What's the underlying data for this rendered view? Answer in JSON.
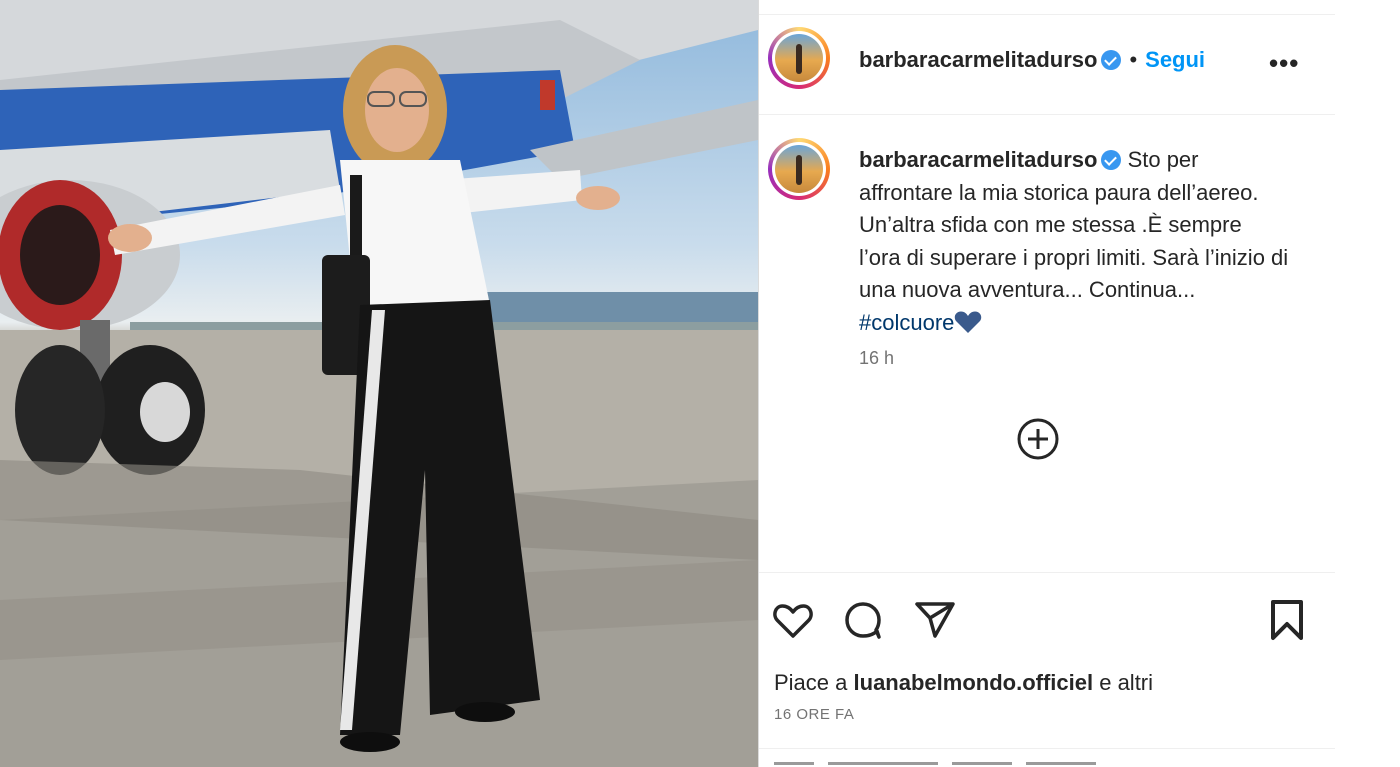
{
  "post": {
    "username": "barbaracarmelitadurso",
    "verified": true,
    "separator": "•",
    "follow_label": "Segui",
    "more_label": "•••"
  },
  "caption": {
    "username": "barbaracarmelitadurso",
    "text": "Sto per affrontare la mia storica paura dell’aereo. Un’altra sfida con me stessa .È sempre l’ora di superare i propri limiti. Sarà l’inizio di una nuova avventura... Continua...",
    "hashtag": "#colcuore"
  },
  "time_ago": "16 h",
  "likes": {
    "prefix": "Piace a",
    "user": "luanabelmondo.officiel",
    "suffix": "e altri"
  },
  "date": "16 ORE FA",
  "icons": {
    "like": "heart-icon",
    "comment": "comment-icon",
    "share": "paper-plane-icon",
    "save": "bookmark-icon",
    "load_more": "plus-circle-icon",
    "verified": "verified-badge-icon"
  },
  "colors": {
    "link_blue": "#0095f6",
    "hashtag": "#00376b",
    "verified": "#3897f0",
    "heart_emoji": "#3a5a8c"
  }
}
